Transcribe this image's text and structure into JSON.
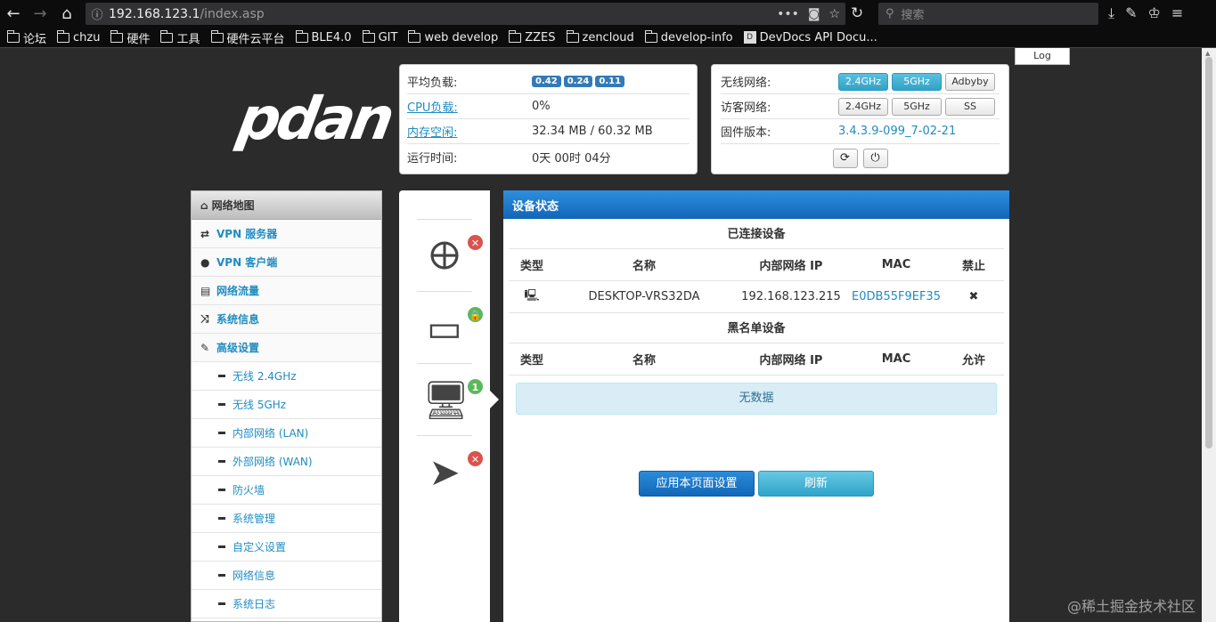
{
  "browser": {
    "url_host": "192.168.123.1",
    "url_path": "/index.asp",
    "search_placeholder": "搜索",
    "bookmarks": [
      "论坛",
      "chzu",
      "硬件",
      "工具",
      "硬件云平台",
      "BLE4.0",
      "GIT",
      "web develop",
      "ZZES",
      "zencloud",
      "develop-info",
      "DevDocs API Docu..."
    ]
  },
  "log_button": "Log",
  "logo": "pdan",
  "status": {
    "load_label": "平均负载:",
    "loads": [
      "0.42",
      "0.24",
      "0.11"
    ],
    "cpu_label": "CPU负载:",
    "cpu_value": "0%",
    "mem_label": "内存空闲:",
    "mem_value": "32.34 MB / 60.32 MB",
    "uptime_label": "运行时间:",
    "uptime_value": "0天 00时 04分"
  },
  "wireless": {
    "wifi_label": "无线网络:",
    "wifi_24": "2.4GHz",
    "wifi_5": "5GHz",
    "adbyby": "Adbyby",
    "guest_label": "访客网络:",
    "guest_24": "2.4GHz",
    "guest_5": "5GHz",
    "ss": "SS",
    "fw_label": "固件版本:",
    "fw_value": "3.4.3.9-099_7-02-21"
  },
  "menu": {
    "header": "网络地图",
    "items": [
      "VPN 服务器",
      "VPN 客户端",
      "网络流量",
      "系统信息",
      "高级设置"
    ],
    "subitems": [
      "无线 2.4GHz",
      "无线 5GHz",
      "内部网络 (LAN)",
      "外部网络 (WAN)",
      "防火墙",
      "系统管理",
      "自定义设置",
      "网络信息",
      "系统日志"
    ]
  },
  "device_badge": "1",
  "main": {
    "title": "设备状态",
    "connected_title": "已连接设备",
    "blacklist_title": "黑名单设备",
    "col_type": "类型",
    "col_name": "名称",
    "col_ip": "内部网络 IP",
    "col_mac": "MAC",
    "col_ban": "禁止",
    "col_allow": "允许",
    "device_name": "DESKTOP-VRS32DA",
    "device_ip": "192.168.123.215",
    "device_mac": "E0DB55F9EF35",
    "empty": "无数据",
    "apply": "应用本页面设置",
    "refresh": "刷新"
  },
  "watermark": "@稀土掘金技术社区"
}
